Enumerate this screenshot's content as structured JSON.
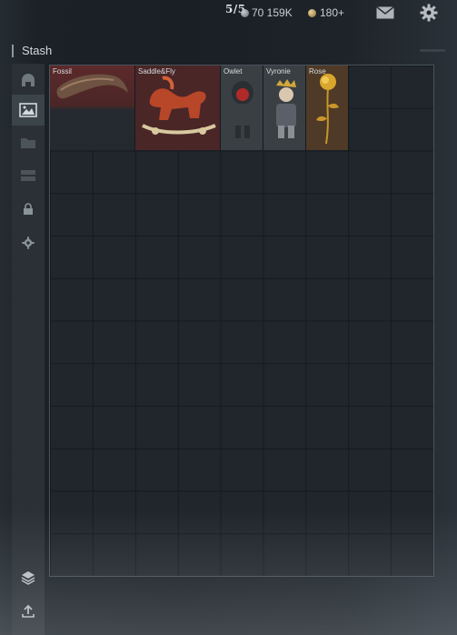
{
  "header": {
    "slots": "5/5",
    "currency_amount": "70 159K",
    "currency_icon": "silver-coin-icon",
    "gold_amount": "180+",
    "gold_icon": "gold-coin-icon",
    "mail_icon": "mail-icon",
    "settings_icon": "gear-icon"
  },
  "stash": {
    "title": "Stash",
    "sidebar": [
      {
        "icon": "helmet-icon",
        "active": false
      },
      {
        "icon": "gallery-icon",
        "active": true
      },
      {
        "icon": "folder-icon",
        "active": false
      },
      {
        "icon": "storage-icon",
        "active": false
      },
      {
        "icon": "lock-icon",
        "active": false
      },
      {
        "icon": "gear-icon",
        "active": false
      },
      {
        "icon": "layers-icon",
        "active": false
      },
      {
        "icon": "upload-icon",
        "active": false
      }
    ],
    "grid": {
      "columns": 9,
      "rows": 12
    },
    "items": [
      {
        "name": "Fossil",
        "color": "#5a2a2a"
      },
      {
        "name": "Saddle&Fly",
        "color": "#5a2a2a"
      },
      {
        "name": "Owlet",
        "color": "#3a3f44"
      },
      {
        "name": "Vyronie",
        "color": "#3a3f44"
      },
      {
        "name": "Rose",
        "color": "#4e3a26"
      }
    ]
  }
}
